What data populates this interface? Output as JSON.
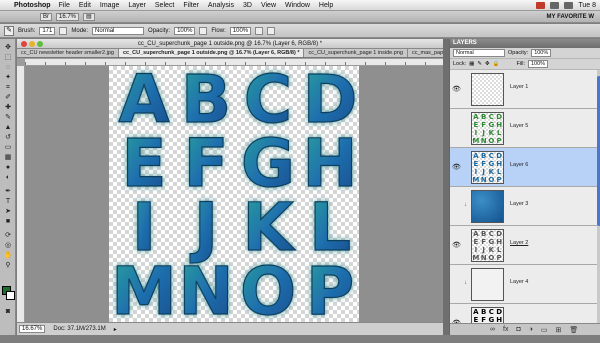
{
  "menubar": {
    "apple_glyph": "",
    "app_name": "Photoshop",
    "items": [
      "File",
      "Edit",
      "Image",
      "Layer",
      "Select",
      "Filter",
      "Analysis",
      "3D",
      "View",
      "Window",
      "Help"
    ],
    "clock": "Tue 8"
  },
  "appbar": {
    "zoom": "16.7%",
    "workspace": "MY FAVORITE W"
  },
  "options": {
    "brush_label": "Brush:",
    "brush_size": "171",
    "mode_label": "Mode:",
    "mode_value": "Normal",
    "opacity_label": "Opacity:",
    "opacity_value": "100%",
    "flow_label": "Flow:",
    "flow_value": "100%"
  },
  "document": {
    "title": "cc_CU_superchunk_page 1 outside.png @ 16.7% (Layer 6, RGB/8) *",
    "tabs": [
      {
        "label": "cc_CU newsletter header smaller2.jpg",
        "active": false
      },
      {
        "label": "cc_CU_superchunk_page 1 outside.png @ 16.7% (Layer 6, RGB/8) *",
        "active": true
      },
      {
        "label": "cc_CU_superchunk_page 1 inside.png",
        "active": false
      },
      {
        "label": "cc_mas_paper 18",
        "active": false
      }
    ],
    "letters": [
      "A",
      "B",
      "C",
      "D",
      "E",
      "F",
      "G",
      "H",
      "I",
      "J",
      "K",
      "L",
      "M",
      "N",
      "O",
      "P"
    ],
    "status_zoom": "16.67%",
    "status_doc": "Doc: 37.1M/273.1M"
  },
  "layers_panel": {
    "title": "LAYERS",
    "blend_mode": "Normal",
    "opacity_label": "Opacity:",
    "opacity_value": "100%",
    "lock_label": "Lock:",
    "fill_label": "Fill:",
    "fill_value": "100%",
    "layers": [
      {
        "name": "Layer 1",
        "thumb": "checker",
        "selected": false
      },
      {
        "name": "Layer 5",
        "thumb": "green-letters",
        "selected": false
      },
      {
        "name": "Layer 6",
        "thumb": "blue-letters",
        "selected": true
      },
      {
        "name": "Layer 3",
        "thumb": "blue-fill",
        "selected": false
      },
      {
        "name": "Layer 2",
        "thumb": "gray-letters",
        "selected": false
      },
      {
        "name": "Layer 4",
        "thumb": "white-fill",
        "selected": false
      },
      {
        "name": "",
        "thumb": "black-letters",
        "selected": false
      }
    ]
  },
  "colors": {
    "foreground": "#1f6d2b",
    "background": "#ffffff",
    "selection": "#b7d2f6",
    "letter_fill": "#1f73a8",
    "letter_glow": "#2a9a8f"
  }
}
